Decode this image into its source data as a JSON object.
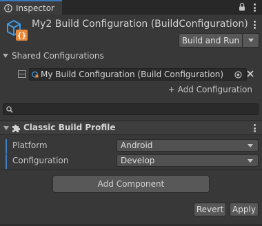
{
  "tab": {
    "label": "Inspector",
    "icon": "info-icon",
    "controls": [
      "lock-icon",
      "kebab-menu-icon"
    ]
  },
  "header": {
    "title": "My2 Build Configuration (BuildConfiguration)",
    "icon": "build-configuration-asset-icon",
    "build_button": {
      "label": "Build and Run",
      "dropdown_icon": "chevron-down-icon"
    }
  },
  "shared": {
    "section_label": "Shared Configurations",
    "items": [
      {
        "label": "My Build Configuration (Build Configuration)",
        "icon": "build-configuration-icon",
        "picker_icon": "object-picker-icon",
        "remove_icon": "close-icon"
      }
    ],
    "add_label": "+ Add Configuration"
  },
  "search": {
    "value": "",
    "icon": "search-icon"
  },
  "component": {
    "title": "Classic Build Profile",
    "icon": "puzzle-piece-icon",
    "properties": [
      {
        "label": "Platform",
        "value": "Android"
      },
      {
        "label": "Configuration",
        "value": "Develop"
      }
    ]
  },
  "add_component_label": "Add Component",
  "footer": {
    "revert_label": "Revert",
    "apply_label": "Apply"
  },
  "colors": {
    "background": "#383838",
    "accent": "#3c7fc5",
    "asset_icon_blue": "#3e9be6",
    "asset_icon_orange": "#e8893c"
  }
}
